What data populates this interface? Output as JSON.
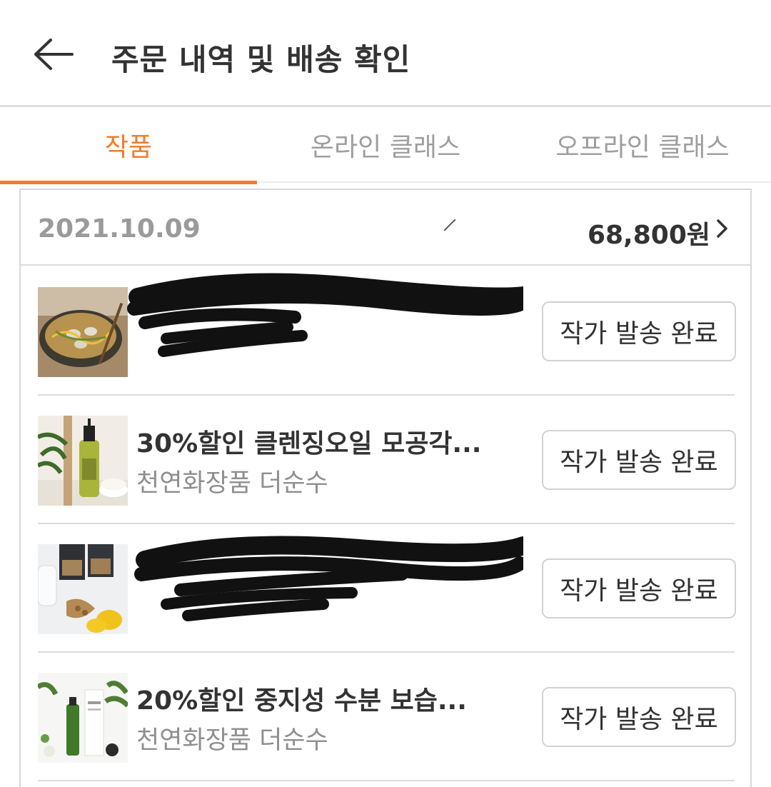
{
  "header": {
    "title": "주문 내역 및 배송 확인",
    "back_icon": "arrow-left-icon"
  },
  "tabs": [
    {
      "label": "작품",
      "active": true
    },
    {
      "label": "온라인 클래스",
      "active": false
    },
    {
      "label": "오프라인 클래스",
      "active": false
    }
  ],
  "order": {
    "date": "2021.10.09",
    "total": "68,800원",
    "items": [
      {
        "title": "",
        "seller": "",
        "status": "작가 발송 완료",
        "redacted": true,
        "thumb": "noodle-bowl-photo"
      },
      {
        "title": "30%할인 클렌징오일 모공각...",
        "seller": "천연화장품 더순수",
        "status": "작가 발송 완료",
        "redacted": false,
        "thumb": "cleansing-oil-bottle-photo"
      },
      {
        "title": "",
        "seller": "",
        "status": "작가 발송 완료",
        "redacted": true,
        "thumb": "granola-lemon-photo"
      },
      {
        "title": "20%할인 중지성 수분 보습...",
        "seller": "천연화장품 더순수",
        "status": "작가 발송 완료",
        "redacted": false,
        "thumb": "green-mist-bottle-photo"
      }
    ]
  },
  "colors": {
    "accent": "#f47b2a",
    "text": "#333333",
    "muted": "#9a9a9a"
  }
}
